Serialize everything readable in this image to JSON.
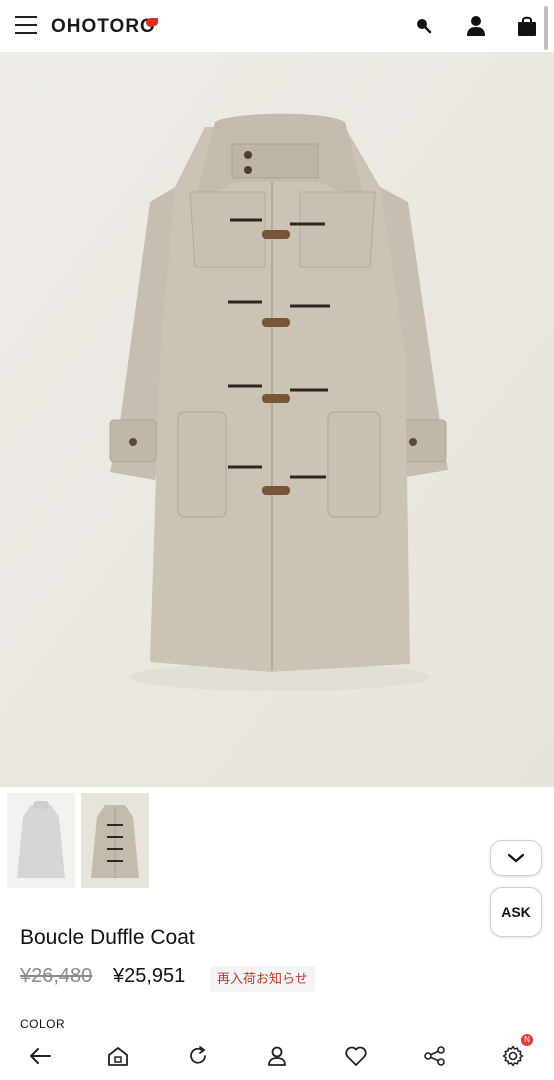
{
  "header": {
    "logo_text": "OHOTORO",
    "icons": [
      "menu-icon",
      "search-icon",
      "account-icon",
      "bag-icon"
    ]
  },
  "product": {
    "title": "Boucle Duffle Coat",
    "original_price": "¥26,480",
    "sale_price": "¥25,951",
    "restock_label": "再入荷お知らせ",
    "color_label": "COLOR"
  },
  "floating": {
    "ask_label": "ASK"
  },
  "bottom_nav": {
    "icons": [
      "back-arrow-icon",
      "home-icon",
      "refresh-icon",
      "user-icon",
      "heart-icon",
      "share-icon",
      "settings-icon"
    ],
    "settings_badge": "N"
  },
  "colors": {
    "accent_red": "#d9301f",
    "coat_beige": "#c9c1b2",
    "background": "#ece9e3"
  }
}
